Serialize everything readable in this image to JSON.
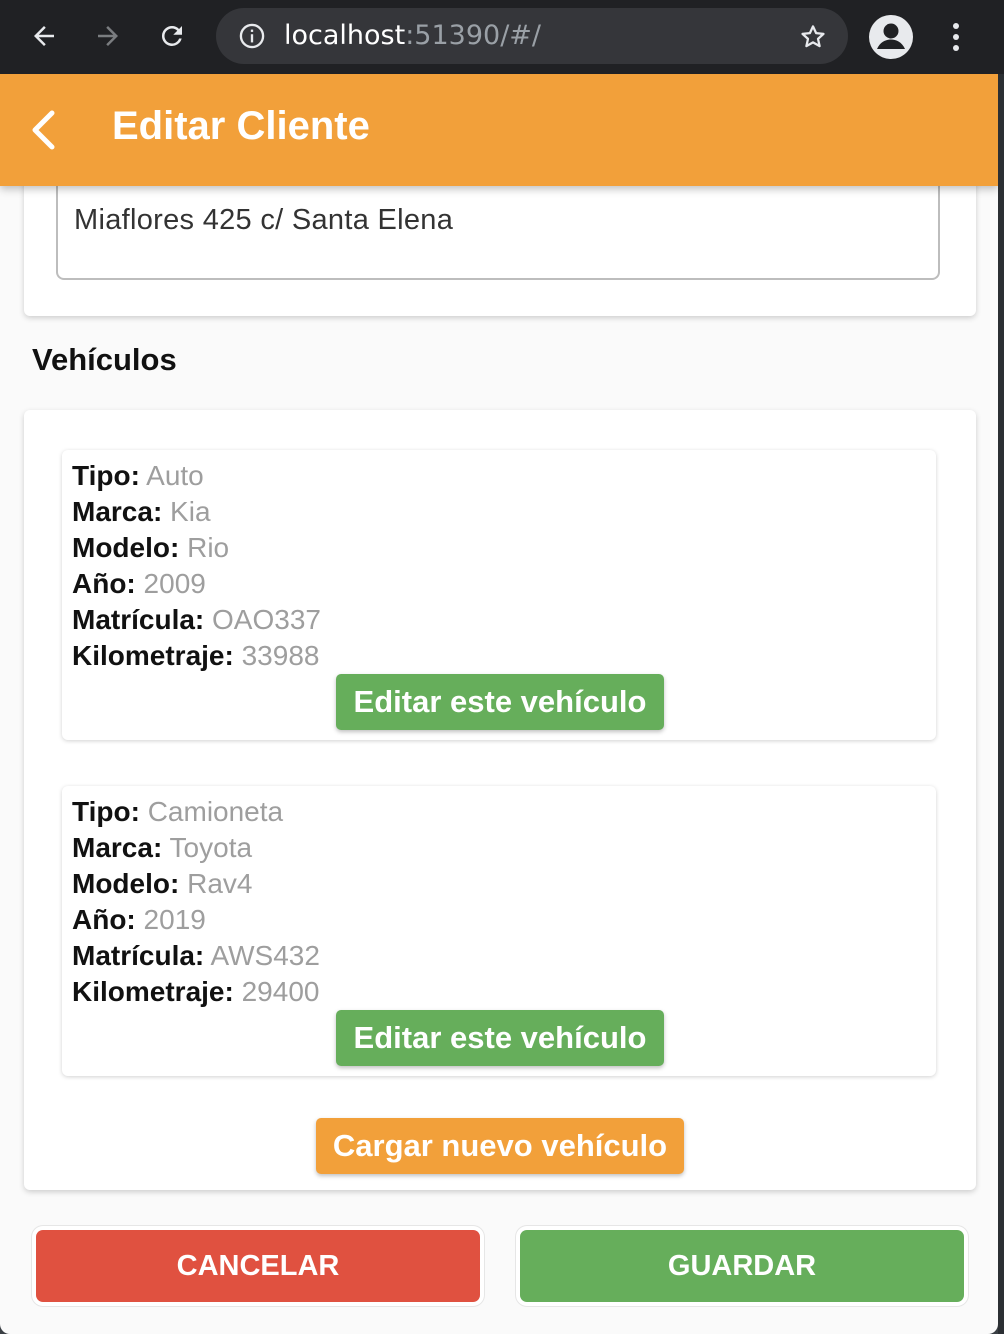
{
  "browser": {
    "url_host": "localhost",
    "url_rest": ":51390/#/"
  },
  "appbar": {
    "title": "Editar Cliente"
  },
  "address_field": {
    "value": "Miaflores 425 c/ Santa Elena"
  },
  "vehicles_section": {
    "title": "Vehículos",
    "labels": {
      "tipo": "Tipo:",
      "marca": "Marca:",
      "modelo": "Modelo:",
      "anio": "Año:",
      "matricula": "Matrícula:",
      "kilometraje": "Kilometraje:"
    },
    "items": [
      {
        "tipo": "Auto",
        "marca": "Kia",
        "modelo": "Rio",
        "anio": "2009",
        "matricula": "OAO337",
        "kilometraje": "33988",
        "edit_label": "Editar este vehículo"
      },
      {
        "tipo": "Camioneta",
        "marca": "Toyota",
        "modelo": "Rav4",
        "anio": "2019",
        "matricula": "AWS432",
        "kilometraje": "29400",
        "edit_label": "Editar este vehículo"
      }
    ],
    "add_label": "Cargar nuevo vehículo"
  },
  "footer": {
    "cancel_label": "CANCELAR",
    "save_label": "GUARDAR"
  },
  "colors": {
    "primary": "#f2a03a",
    "success": "#66ae5b",
    "danger": "#e05140"
  }
}
